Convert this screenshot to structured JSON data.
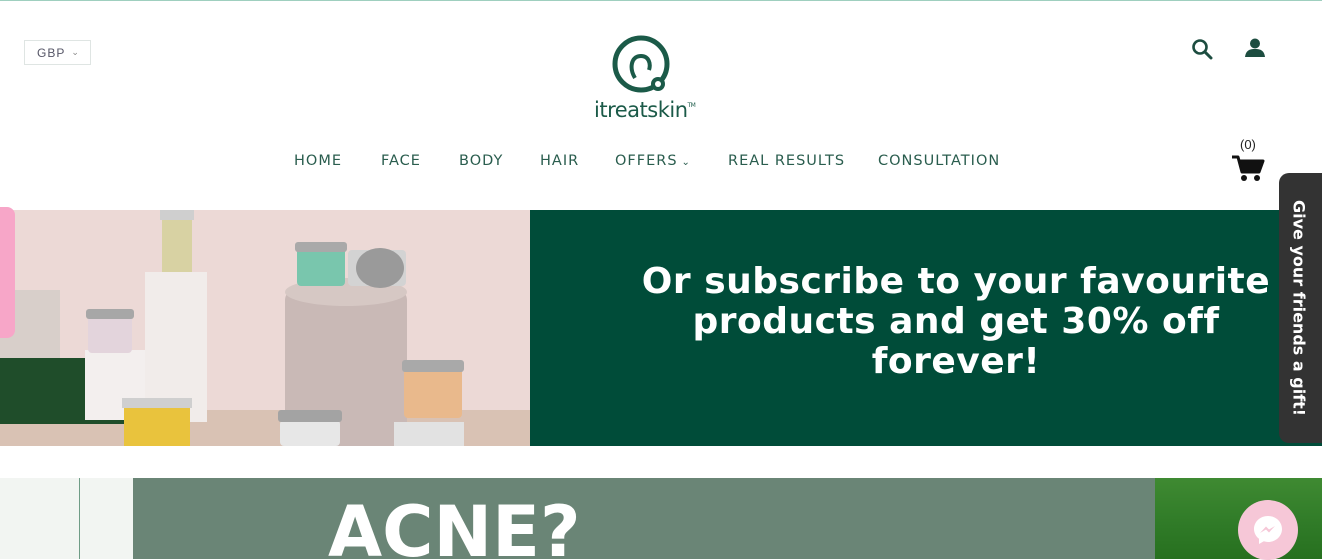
{
  "header": {
    "currency": "GBP",
    "logo_text": "itreatskin",
    "logo_tm": "TM"
  },
  "nav": {
    "items": [
      {
        "label": "HOME"
      },
      {
        "label": "FACE"
      },
      {
        "label": "BODY"
      },
      {
        "label": "HAIR"
      },
      {
        "label": "OFFERS"
      },
      {
        "label": "REAL RESULTS"
      },
      {
        "label": "CONSULTATION"
      }
    ]
  },
  "cart": {
    "count": "(0)"
  },
  "banner": {
    "line1": "Or subscribe to your favourite",
    "line2": "products and get 30% off",
    "line3": "forever!"
  },
  "gift_tab": {
    "label": "Give your friends a gift!"
  },
  "promo": {
    "headline": "ACNE?"
  },
  "icons": {
    "search": "search-icon",
    "account": "user-icon",
    "cart": "cart-icon",
    "messenger": "messenger-icon"
  },
  "colors": {
    "brand_green": "#004c39",
    "nav_text": "#2a5d4e",
    "gift_tab_bg": "#333333",
    "pink_accent": "#f7a6c8"
  }
}
